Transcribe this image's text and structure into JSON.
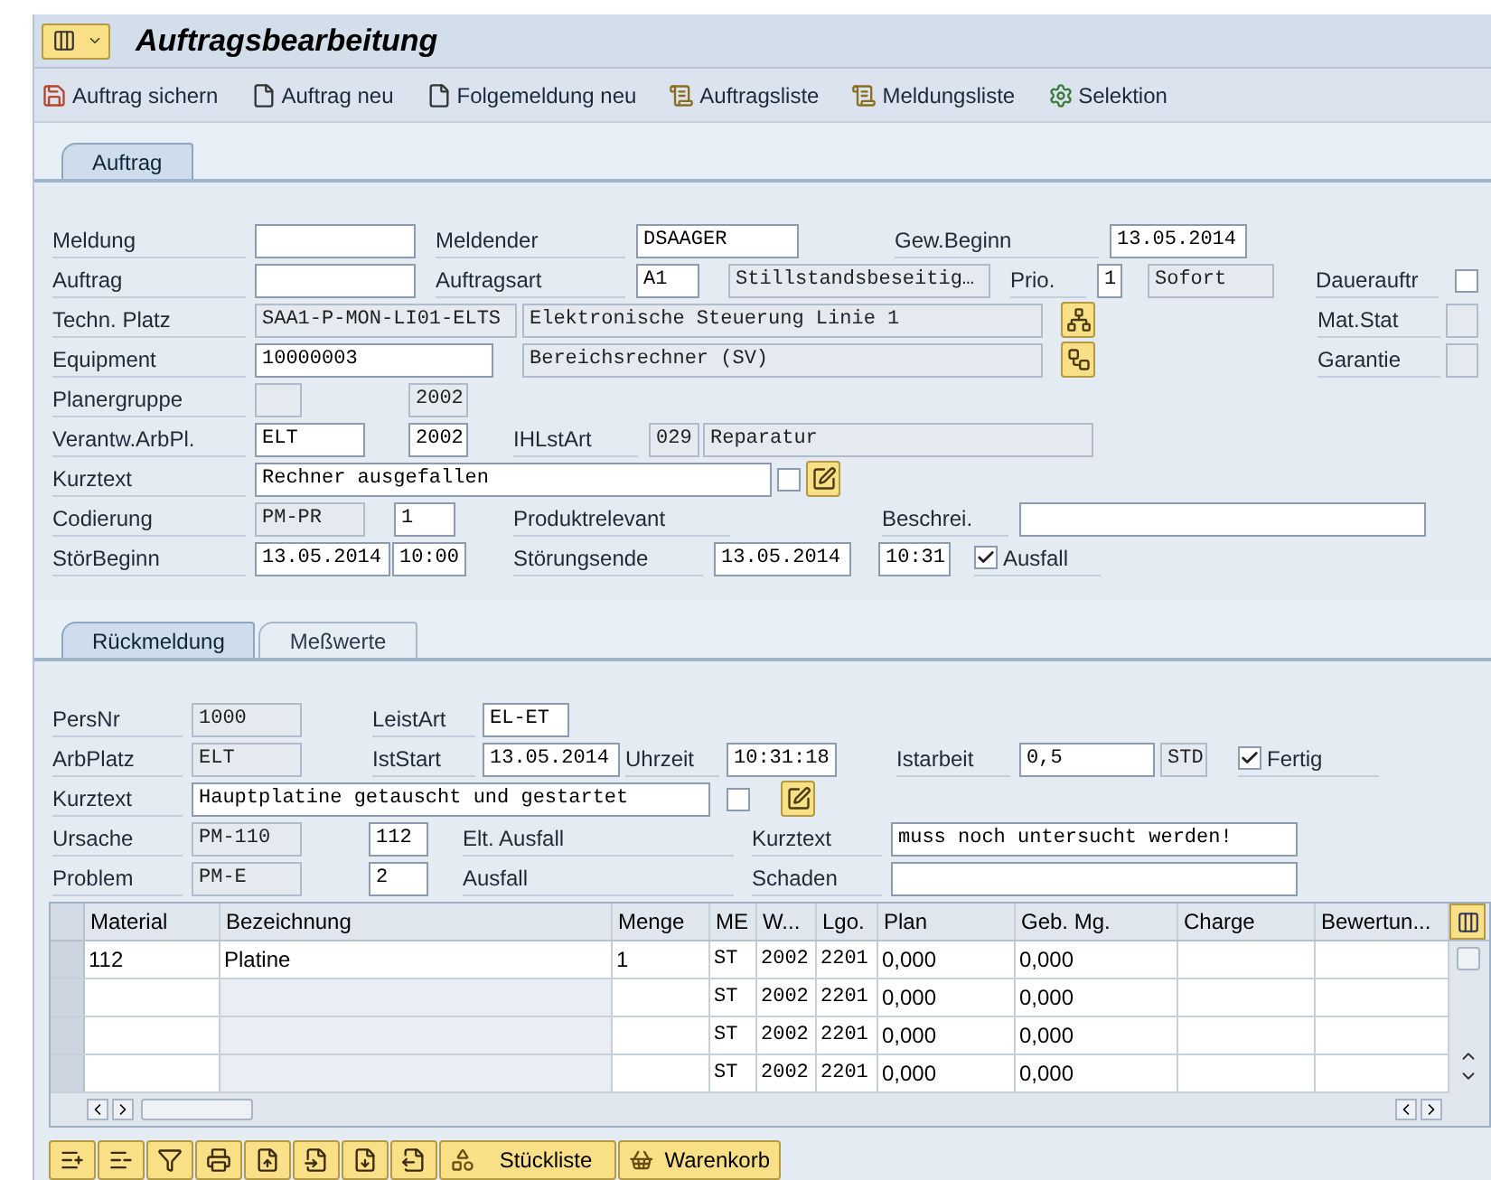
{
  "title": "Auftragsbearbeitung",
  "toolbar": [
    {
      "label": "Auftrag sichern"
    },
    {
      "label": "Auftrag neu"
    },
    {
      "label": "Folgemeldung neu"
    },
    {
      "label": "Auftragsliste"
    },
    {
      "label": "Meldungsliste"
    },
    {
      "label": "Selektion"
    }
  ],
  "order_tabs": [
    {
      "label": "Auftrag",
      "selected": true
    }
  ],
  "order_form": [
    [
      {
        "kind": "label",
        "text": "Meldung"
      },
      {
        "kind": "field",
        "editable": true
      },
      {
        "kind": "label",
        "text": "Meldender"
      },
      {
        "kind": "field",
        "value": "DSAAGER",
        "editable": true
      },
      {
        "kind": "label",
        "text": "Gew.Beginn"
      },
      {
        "kind": "field",
        "value": "13.05.2014",
        "editable": true
      }
    ],
    [
      {
        "kind": "label",
        "text": "Auftrag"
      },
      {
        "kind": "field",
        "editable": true
      },
      {
        "kind": "label",
        "text": "Auftragsart"
      },
      {
        "kind": "field",
        "value": "A1",
        "editable": true
      },
      {
        "kind": "field",
        "value": "Stillstandsbeseitig…",
        "editable": false
      },
      {
        "kind": "label",
        "text": "Prio."
      },
      {
        "kind": "field",
        "value": "1",
        "editable": true
      },
      {
        "kind": "field",
        "value": "Sofort",
        "editable": false
      },
      {
        "kind": "label",
        "text": "Dauerauftr"
      },
      {
        "kind": "checkbox",
        "checked": false
      }
    ],
    [
      {
        "kind": "label",
        "text": "Techn. Platz"
      },
      {
        "kind": "field",
        "value": "SAA1-P-MON-LI01-ELTS",
        "editable": false
      },
      {
        "kind": "field",
        "value": "Elektronische Steuerung Linie 1",
        "editable": false
      },
      {
        "kind": "icon_button"
      },
      {
        "kind": "label",
        "text": "Mat.Stat"
      },
      {
        "kind": "field",
        "editable": false
      }
    ],
    [
      {
        "kind": "label",
        "text": "Equipment"
      },
      {
        "kind": "field",
        "value": "10000003",
        "editable": true
      },
      {
        "kind": "field",
        "value": "Bereichsrechner (SV)",
        "editable": false
      },
      {
        "kind": "icon_button"
      },
      {
        "kind": "label",
        "text": "Garantie"
      },
      {
        "kind": "field",
        "editable": false
      }
    ],
    [
      {
        "kind": "label",
        "text": "Planergruppe"
      },
      {
        "kind": "field",
        "editable": false
      },
      {
        "kind": "field",
        "value": "2002",
        "editable": false
      }
    ],
    [
      {
        "kind": "label",
        "text": "Verantw.ArbPl."
      },
      {
        "kind": "field",
        "value": "ELT",
        "editable": true
      },
      {
        "kind": "field",
        "value": "2002",
        "editable": true
      },
      {
        "kind": "label",
        "text": "IHLstArt"
      },
      {
        "kind": "field",
        "value": "029",
        "editable": false
      },
      {
        "kind": "field",
        "value": "Reparatur",
        "editable": false
      }
    ],
    [
      {
        "kind": "label",
        "text": "Kurztext"
      },
      {
        "kind": "field",
        "value": "Rechner ausgefallen",
        "editable": true
      },
      {
        "kind": "checkbox",
        "checked": false
      },
      {
        "kind": "icon_button"
      }
    ],
    [
      {
        "kind": "label",
        "text": "Codierung"
      },
      {
        "kind": "field",
        "value": "PM-PR",
        "editable": false
      },
      {
        "kind": "field",
        "value": "1",
        "editable": true
      },
      {
        "kind": "label",
        "text": "Produktrelevant"
      },
      {
        "kind": "label",
        "text": "Beschrei."
      },
      {
        "kind": "field",
        "editable": true
      }
    ],
    [
      {
        "kind": "label",
        "text": "StörBeginn"
      },
      {
        "kind": "field",
        "value": "13.05.2014",
        "editable": true
      },
      {
        "kind": "field",
        "value": "10:00",
        "editable": true
      },
      {
        "kind": "label",
        "text": "Störungsende"
      },
      {
        "kind": "field",
        "value": "13.05.2014",
        "editable": true
      },
      {
        "kind": "field",
        "value": "10:31",
        "editable": true
      },
      {
        "kind": "checkbox",
        "checked": true,
        "label": "Ausfall"
      }
    ]
  ],
  "confirmation_tabs": [
    {
      "label": "Rückmeldung",
      "selected": true
    },
    {
      "label": "Meßwerte",
      "selected": false
    }
  ],
  "confirmation_form": [
    [
      {
        "kind": "label",
        "text": "PersNr"
      },
      {
        "kind": "field",
        "value": "1000",
        "editable": false
      },
      {
        "kind": "label",
        "text": "LeistArt"
      },
      {
        "kind": "field",
        "value": "EL-ET",
        "editable": true
      }
    ],
    [
      {
        "kind": "label",
        "text": "ArbPlatz"
      },
      {
        "kind": "field",
        "value": "ELT",
        "editable": false
      },
      {
        "kind": "label",
        "text": "IstStart"
      },
      {
        "kind": "field",
        "value": "13.05.2014",
        "editable": true
      },
      {
        "kind": "label",
        "text": "Uhrzeit"
      },
      {
        "kind": "field",
        "value": "10:31:18",
        "editable": true
      },
      {
        "kind": "label",
        "text": "Istarbeit"
      },
      {
        "kind": "field",
        "value": "0,5",
        "editable": true
      },
      {
        "kind": "field",
        "value": "STD",
        "editable": false
      },
      {
        "kind": "checkbox",
        "checked": true,
        "label": "Fertig"
      }
    ],
    [
      {
        "kind": "label",
        "text": "Kurztext"
      },
      {
        "kind": "field",
        "value": "Hauptplatine getauscht und gestartet",
        "editable": true
      },
      {
        "kind": "checkbox",
        "checked": false
      },
      {
        "kind": "icon_button"
      }
    ],
    [
      {
        "kind": "label",
        "text": "Ursache"
      },
      {
        "kind": "field",
        "value": "PM-110",
        "editable": false
      },
      {
        "kind": "field",
        "value": "112",
        "editable": true
      },
      {
        "kind": "label",
        "text": "Elt. Ausfall"
      },
      {
        "kind": "label",
        "text": "Kurztext"
      },
      {
        "kind": "field",
        "value": "muss noch untersucht werden!",
        "editable": true
      }
    ],
    [
      {
        "kind": "label",
        "text": "Problem"
      },
      {
        "kind": "field",
        "value": "PM-E",
        "editable": false
      },
      {
        "kind": "field",
        "value": "2",
        "editable": true
      },
      {
        "kind": "label",
        "text": "Ausfall"
      },
      {
        "kind": "label",
        "text": "Schaden"
      },
      {
        "kind": "field",
        "editable": true
      }
    ]
  ],
  "components_table": {
    "columns": [
      "Material",
      "Bezeichnung",
      "Menge",
      "ME",
      "W...",
      "Lgo.",
      "Plan",
      "Geb. Mg.",
      "Charge",
      "Bewertun..."
    ],
    "rows": [
      [
        "112",
        "Platine",
        "1",
        "ST",
        "2002",
        "2201",
        "0,000",
        "0,000",
        null,
        null
      ],
      [
        null,
        null,
        null,
        "ST",
        "2002",
        "2201",
        "0,000",
        "0,000",
        null,
        null
      ],
      [
        null,
        null,
        null,
        "ST",
        "2002",
        "2201",
        "0,000",
        "0,000",
        null,
        null
      ],
      [
        null,
        null,
        null,
        "ST",
        "2002",
        "2201",
        "0,000",
        "0,000",
        null,
        null
      ]
    ]
  },
  "bottom_buttons": [
    {
      "label": "Stückliste"
    },
    {
      "label": "Warenkorb"
    }
  ]
}
